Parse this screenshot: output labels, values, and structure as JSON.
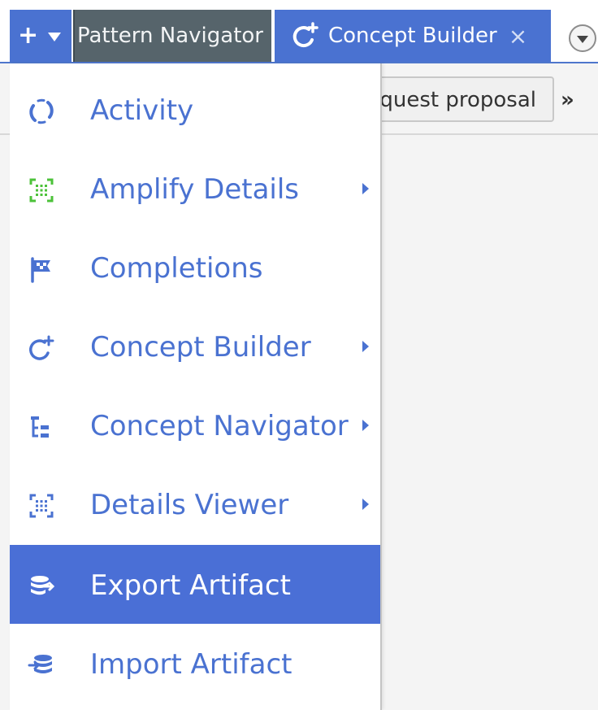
{
  "tabbar": {
    "add_icon": "plus-icon",
    "add_caret_icon": "caret-down-icon",
    "tabs": [
      {
        "label": "Pattern Navigator",
        "active": false
      },
      {
        "label": "Concept Builder",
        "active": true,
        "icon": "concept-builder-icon",
        "close_icon": "close-icon",
        "close_label": "×"
      }
    ],
    "overflow_icon": "circle-caret-down-icon"
  },
  "toolbar": {
    "proposal_label": "Request proposal",
    "more_label": "»"
  },
  "menu": {
    "items": [
      {
        "label": "Activity",
        "icon": "activity-icon",
        "submenu": false,
        "highlighted": false
      },
      {
        "label": "Amplify Details",
        "icon": "amplify-details-icon",
        "submenu": true,
        "highlighted": false
      },
      {
        "label": "Completions",
        "icon": "flag-icon",
        "submenu": false,
        "highlighted": false
      },
      {
        "label": "Concept Builder",
        "icon": "concept-builder-icon",
        "submenu": true,
        "highlighted": false
      },
      {
        "label": "Concept Navigator",
        "icon": "tree-icon",
        "submenu": true,
        "highlighted": false
      },
      {
        "label": "Details Viewer",
        "icon": "details-viewer-icon",
        "submenu": true,
        "highlighted": false
      },
      {
        "label": "Export Artifact",
        "icon": "export-icon",
        "submenu": false,
        "highlighted": true
      },
      {
        "label": "Import Artifact",
        "icon": "import-icon",
        "submenu": false,
        "highlighted": false
      }
    ]
  },
  "colors": {
    "accent": "#4a72d1",
    "highlight": "#4a6fd6",
    "inactive_tab": "#56646b",
    "amplify_icon": "#4cc23a"
  }
}
